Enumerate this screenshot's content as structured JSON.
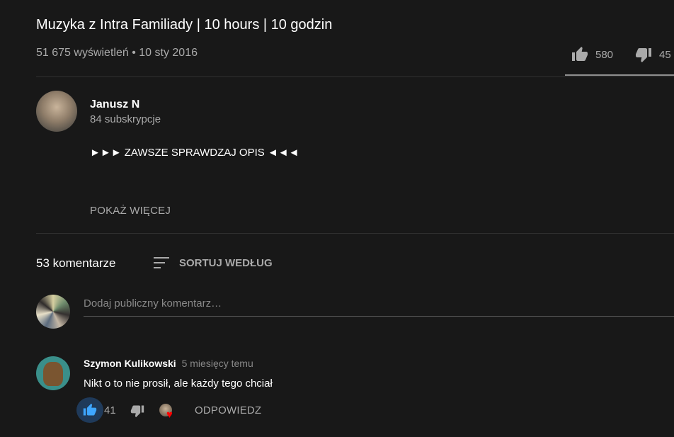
{
  "video": {
    "title": "Muzyka z Intra Familiady | 10 hours | 10 godzin",
    "views": "51 675 wyświetleń",
    "separator": "•",
    "date": "10 sty 2016",
    "likes": "580",
    "dislikes": "45"
  },
  "channel": {
    "name": "Janusz N",
    "subscribers": "84 subskrypcje",
    "description": "►►► ZAWSZE SPRAWDZAJ OPIS ◄◄◄",
    "show_more_label": "POKAŻ WIĘCEJ"
  },
  "comments_section": {
    "count_label": "53 komentarze",
    "sort_label": "SORTUJ WEDŁUG",
    "input_placeholder": "Dodaj publiczny komentarz…"
  },
  "comments": [
    {
      "author": "Szymon Kulikowski",
      "time": "5 miesięcy temu",
      "text": "Nikt o to nie prosił, ale każdy tego chciał",
      "likes": "41",
      "reply_label": "ODPOWIEDZ"
    }
  ],
  "colors": {
    "background": "#181818",
    "secondary_text": "#aaaaaa",
    "liked_blue": "#3ea6ff",
    "heart_red": "#ff0000"
  },
  "icons": {
    "like": "thumb-up-icon",
    "dislike": "thumb-down-icon",
    "sort": "sort-icon",
    "creator_heart": "heart-icon"
  }
}
